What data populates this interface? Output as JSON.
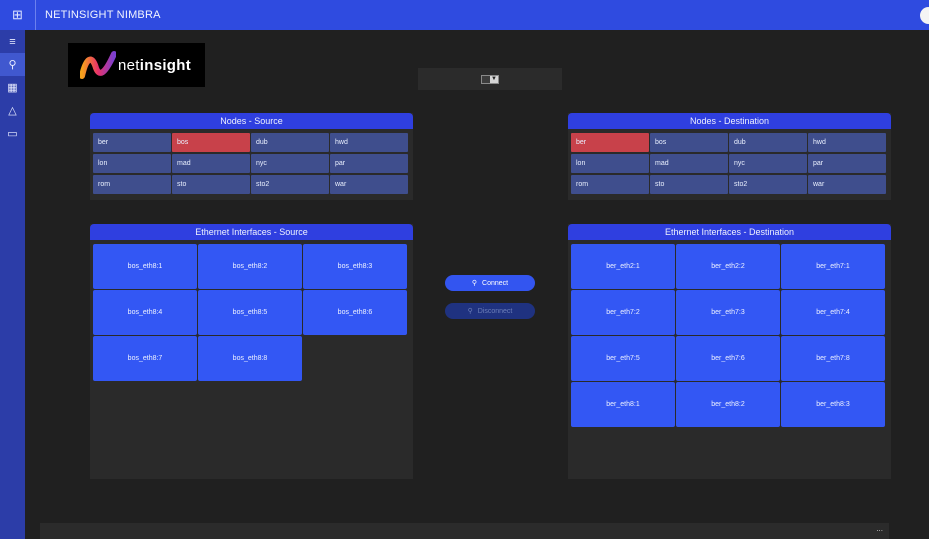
{
  "app": {
    "title": "NETINSIGHT NIMBRA",
    "waffle_icon": "⊞"
  },
  "sidebar": {
    "items": [
      {
        "icon": "≡",
        "name": "menu-icon"
      },
      {
        "icon": "⚲",
        "name": "connect-icon"
      },
      {
        "icon": "▦",
        "name": "dashboard-icon"
      },
      {
        "icon": "△",
        "name": "topology-icon"
      },
      {
        "icon": "▭",
        "name": "video-icon"
      }
    ]
  },
  "logo": {
    "text_prefix": "net",
    "text_bold": "insight"
  },
  "dropdown": {
    "selected": ""
  },
  "source_nodes": {
    "title": "Nodes - Source",
    "nodes": [
      "ber",
      "bos",
      "dub",
      "hwd",
      "lon",
      "mad",
      "nyc",
      "par",
      "rom",
      "sto",
      "sto2",
      "war"
    ],
    "selected": "bos"
  },
  "dest_nodes": {
    "title": "Nodes - Destination",
    "nodes": [
      "ber",
      "bos",
      "dub",
      "hwd",
      "lon",
      "mad",
      "nyc",
      "par",
      "rom",
      "sto",
      "sto2",
      "war"
    ],
    "selected": "ber"
  },
  "source_eth": {
    "title": "Ethernet Interfaces - Source",
    "interfaces": [
      "bos_eth8:1",
      "bos_eth8:2",
      "bos_eth8:3",
      "bos_eth8:4",
      "bos_eth8:5",
      "bos_eth8:6",
      "bos_eth8:7",
      "bos_eth8:8"
    ]
  },
  "dest_eth": {
    "title": "Ethernet Interfaces - Destination",
    "interfaces": [
      "ber_eth2:1",
      "ber_eth2:2",
      "ber_eth7:1",
      "ber_eth7:2",
      "ber_eth7:3",
      "ber_eth7:4",
      "ber_eth7:5",
      "ber_eth7:6",
      "ber_eth7:8",
      "ber_eth8:1",
      "ber_eth8:2",
      "ber_eth8:3"
    ]
  },
  "actions": {
    "connect_label": "Connect",
    "disconnect_label": "Disconnect"
  },
  "status": {
    "more": "..."
  },
  "colors": {
    "accent": "#2f4be0",
    "selected_node": "#c8414a",
    "node": "#3f4e8d",
    "interface": "#3357f4"
  }
}
